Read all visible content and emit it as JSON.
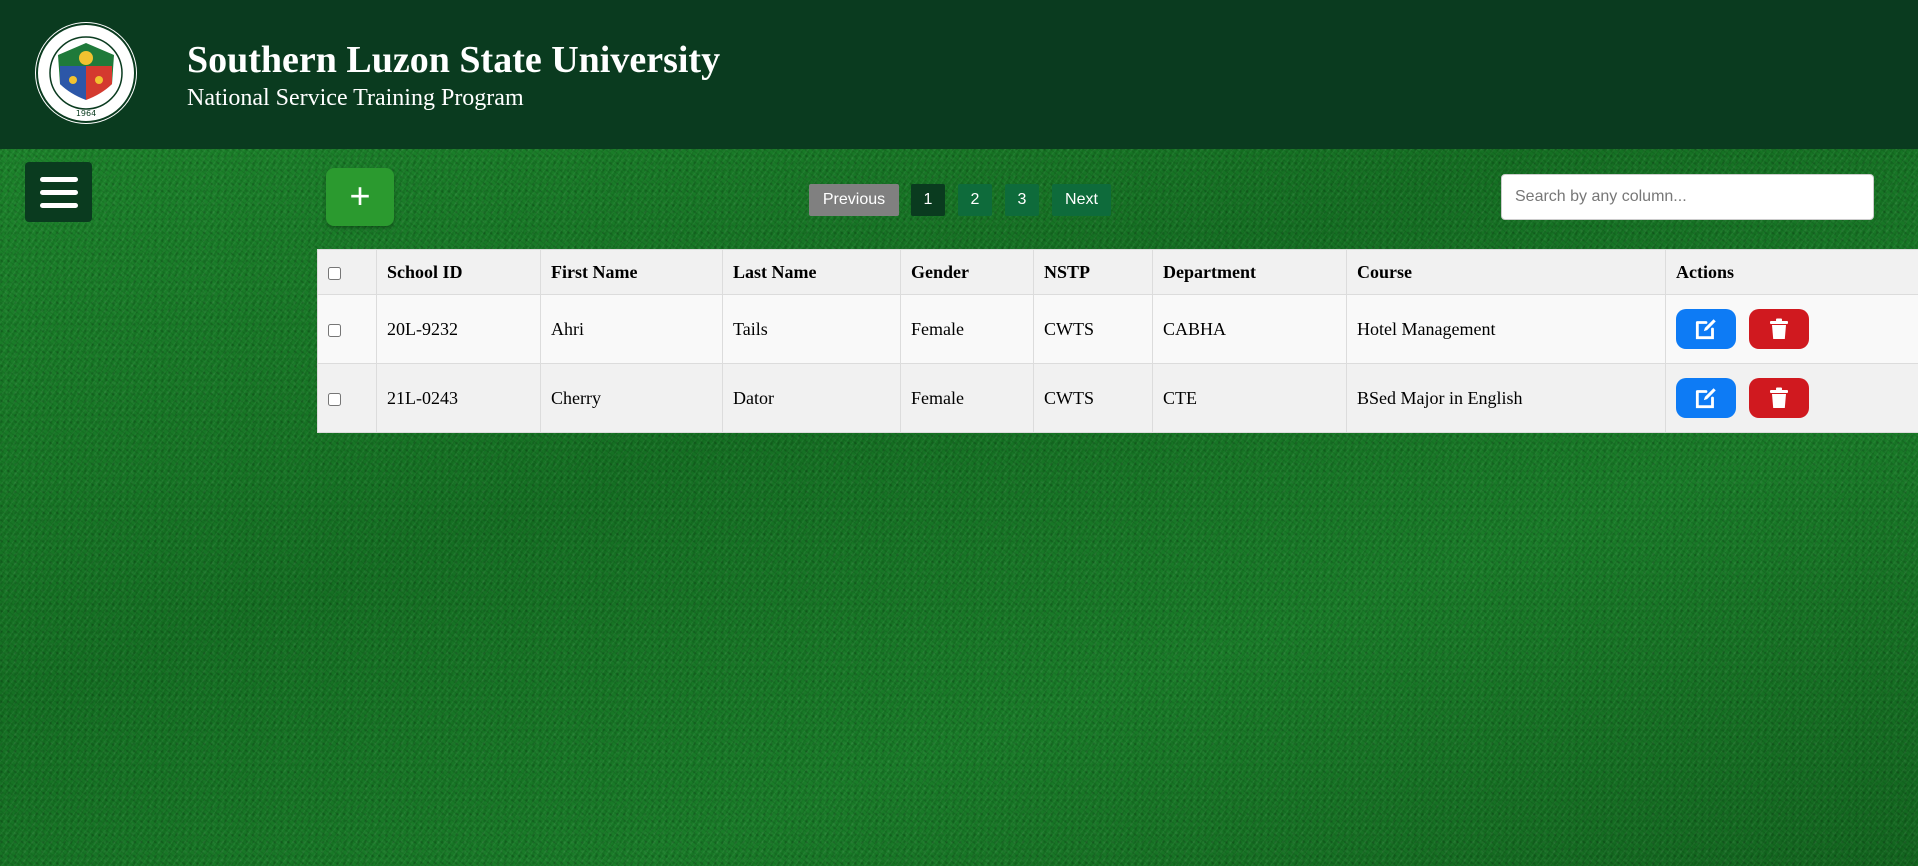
{
  "header": {
    "title": "Southern Luzon State University",
    "subtitle": "National Service Training Program",
    "logo": {
      "icon": "university-seal-icon",
      "text": "SOUTHERN LUZON STATE UNIVERSITY",
      "year": "1964"
    }
  },
  "toolbar": {
    "menu_icon": "hamburger-menu-icon",
    "add_label": "+",
    "search_placeholder": "Search by any column..."
  },
  "pagination": {
    "previous": "Previous",
    "pages": [
      "1",
      "2",
      "3"
    ],
    "active_page": "1",
    "next": "Next"
  },
  "table": {
    "columns": [
      "School ID",
      "First Name",
      "Last Name",
      "Gender",
      "NSTP",
      "Department",
      "Course",
      "Actions"
    ],
    "rows": [
      {
        "school_id": "20L-9232",
        "first_name": "Ahri",
        "last_name": "Tails",
        "gender": "Female",
        "nstp": "CWTS",
        "department": "CABHA",
        "course": "Hotel Management"
      },
      {
        "school_id": "21L-0243",
        "first_name": "Cherry",
        "last_name": "Dator",
        "gender": "Female",
        "nstp": "CWTS",
        "department": "CTE",
        "course": "BSed Major in English"
      }
    ],
    "actions": {
      "edit_icon": "edit-icon",
      "delete_icon": "trash-icon"
    }
  },
  "colors": {
    "header_bg": "#0a3b1f",
    "add_button": "#2b9a2f",
    "edit_button": "#0d7bf5",
    "delete_button": "#d0191f",
    "page_button": "#0e6b3b",
    "previous_button": "#808080"
  }
}
